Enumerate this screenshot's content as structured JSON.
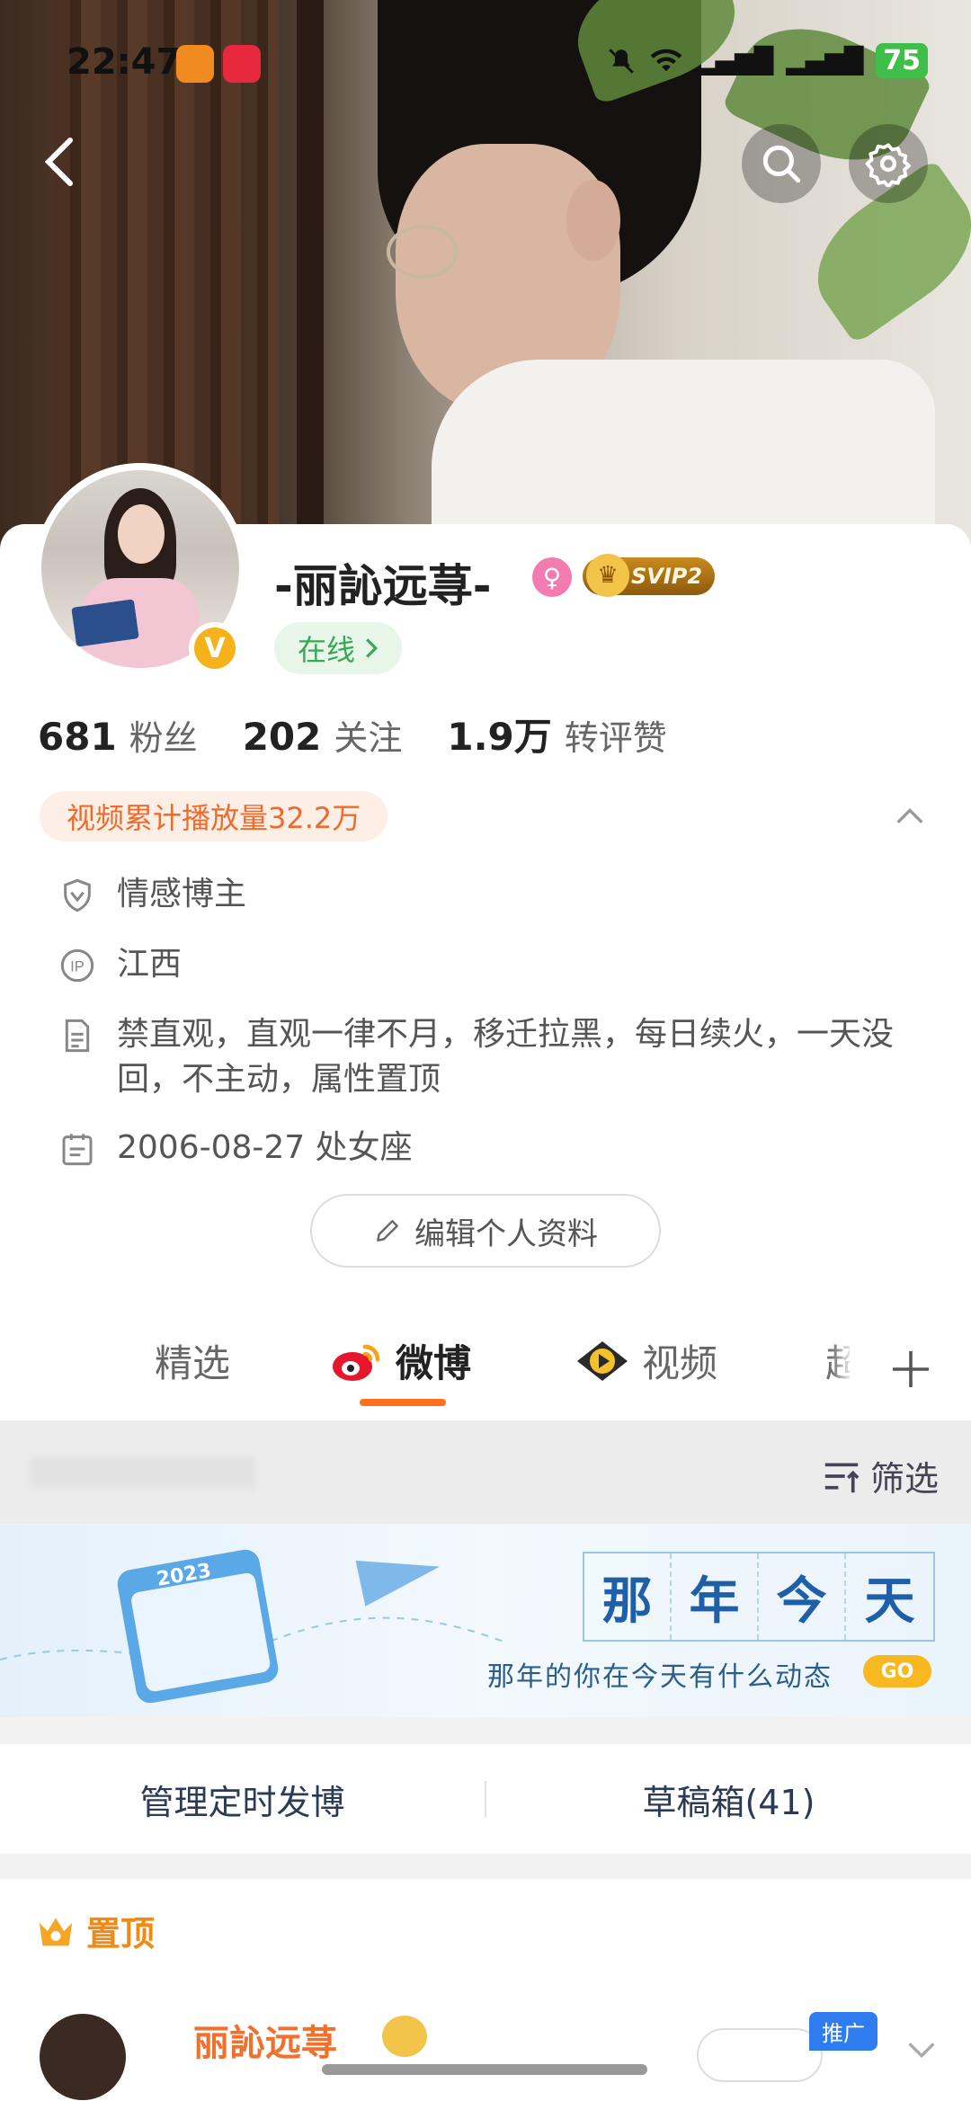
{
  "status_bar": {
    "time": "22:47",
    "battery": "75",
    "network": "4G"
  },
  "profile": {
    "name": "-丽訫远荨-",
    "svip": "SVIP2",
    "online": "在线",
    "verified_mark": "V",
    "stats": [
      {
        "value": "681",
        "label": "粉丝"
      },
      {
        "value": "202",
        "label": "关注"
      },
      {
        "value": "1.9万",
        "label": "转评赞"
      }
    ],
    "play_count": "视频累计播放量32.2万",
    "tag": "情感博主",
    "ip": "江西",
    "bio": "禁直观，直观一律不月，移迁拉黑，每日续火，一天没回，不主动，属性置顶",
    "birthday": "2006-08-27 处女座",
    "edit_button": "编辑个人资料"
  },
  "tabs": [
    {
      "label": "精选",
      "active": false
    },
    {
      "label": "微博",
      "active": true
    },
    {
      "label": "视频",
      "active": false
    },
    {
      "label": "超",
      "active": false
    }
  ],
  "filter": {
    "label": "筛选"
  },
  "banner": {
    "title_chars": [
      "那",
      "年",
      "今",
      "天"
    ],
    "subtitle": "那年的你在今天有什么动态",
    "go": "GO",
    "calendar_year": "2023"
  },
  "manage": {
    "scheduled": "管理定时发博",
    "drafts": "草稿箱(41)"
  },
  "pinned": {
    "header": "置顶",
    "post_author": "丽訫远荨",
    "promo": "推广"
  },
  "colors": {
    "accent_orange": "#ff6f1e",
    "online_green": "#3aa757",
    "pinned_orange": "#f08a12"
  }
}
